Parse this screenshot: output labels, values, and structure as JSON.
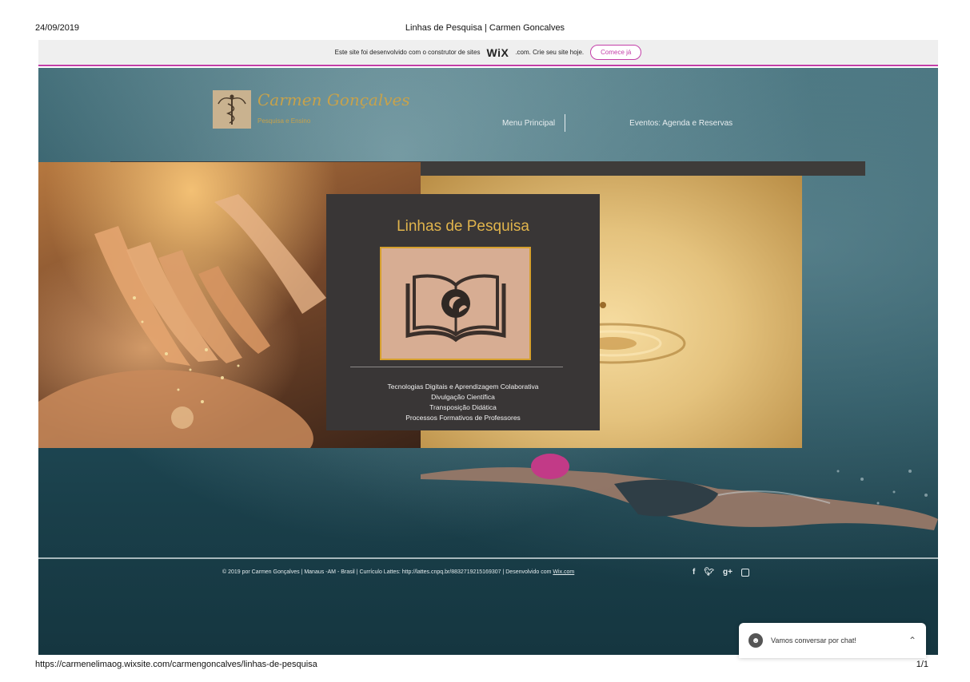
{
  "print": {
    "date": "24/09/2019",
    "title": "Linhas de Pesquisa | Carmen Goncalves",
    "url": "https://carmenelimaog.wixsite.com/carmengoncalves/linhas-de-pesquisa",
    "pages": "1/1"
  },
  "wix_banner": {
    "text": "Este site foi desenvolvido com o construtor de sites",
    "brand": "WiX",
    "suffix": ".com. Crie seu site hoje.",
    "cta": "Comece já"
  },
  "header": {
    "logo_name": "Carmen Gonçalves",
    "logo_sub": "Pesquisa e Ensino",
    "nav": [
      {
        "label": "Menu Principal"
      },
      {
        "label": "Eventos: Agenda e Reservas"
      }
    ]
  },
  "panel": {
    "title": "Linhas de Pesquisa",
    "lines": [
      "Tecnologias Digitais e Aprendizagem Colaborativa",
      "Divulgação Científica",
      "Transposição Didática",
      "Processos Formativos de Professores"
    ]
  },
  "footer": {
    "copyright": "© 2019 por Carmen Gonçalves",
    "location": "Manaus -AM - Brasil",
    "lattes": "Currículo Lattes:  http://lattes.cnpq.br/8832719215169307",
    "dev_prefix": "Desenvolvido com",
    "dev_link": "Wix.com",
    "social": [
      "f",
      "t",
      "g+",
      "instagram"
    ]
  },
  "chat": {
    "label": "Vamos conversar por chat!"
  },
  "icons": {
    "logo": "caduceus-icon",
    "panel": "open-book-icon",
    "chat_avatar": "chat-avatar-icon",
    "chat_toggle": "chevron-up-icon"
  },
  "colors": {
    "wix_accent": "#c33ea8",
    "gold": "#e0b44c",
    "panel_bg": "#393636"
  }
}
